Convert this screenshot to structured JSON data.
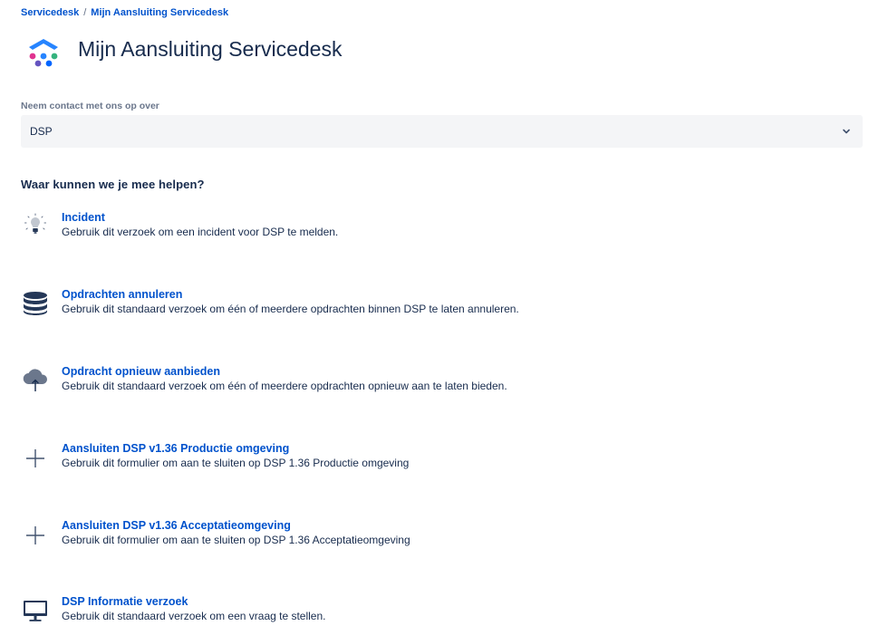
{
  "breadcrumb": {
    "root": "Servicedesk",
    "separator": "/",
    "current": "Mijn Aansluiting Servicedesk"
  },
  "header": {
    "title": "Mijn Aansluiting Servicedesk",
    "logo_icon": "servicedesk-logo-icon"
  },
  "contact": {
    "label": "Neem contact met ons op over",
    "selected": "DSP"
  },
  "help": {
    "heading": "Waar kunnen we je mee helpen?"
  },
  "requests": [
    {
      "icon": "lightbulb-icon",
      "title": "Incident",
      "description": "Gebruik dit verzoek om een incident voor DSP te melden."
    },
    {
      "icon": "database-icon",
      "title": "Opdrachten annuleren",
      "description": "Gebruik dit standaard verzoek om één of meerdere opdrachten binnen DSP te laten annuleren."
    },
    {
      "icon": "cloud-upload-icon",
      "title": "Opdracht opnieuw aanbieden",
      "description": "Gebruik dit standaard verzoek om één of meerdere opdrachten opnieuw aan te laten bieden."
    },
    {
      "icon": "plus-icon",
      "title": "Aansluiten DSP v1.36 Productie omgeving",
      "description": "Gebruik dit formulier om aan te sluiten op DSP 1.36 Productie omgeving"
    },
    {
      "icon": "plus-icon",
      "title": "Aansluiten DSP v1.36 Acceptatieomgeving",
      "description": "Gebruik dit formulier om aan te sluiten op DSP 1.36 Acceptatieomgeving"
    },
    {
      "icon": "monitor-icon",
      "title": "DSP Informatie verzoek",
      "description": "Gebruik dit standaard verzoek om een vraag te stellen."
    }
  ]
}
